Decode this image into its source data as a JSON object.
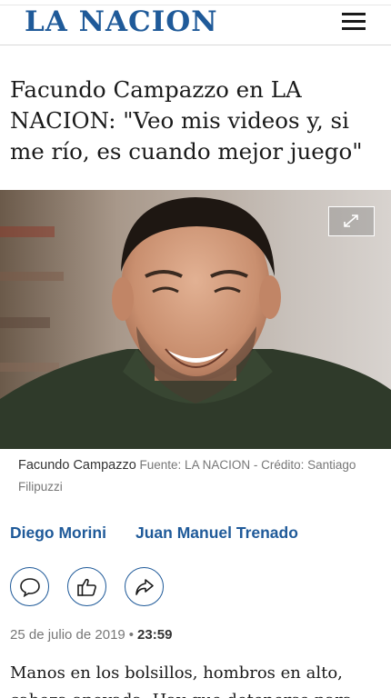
{
  "header": {
    "logo_text": "LA NACION",
    "menu_icon": "hamburger-menu-icon",
    "brand_color": "#1f5a99"
  },
  "article": {
    "headline": "Facundo Campazzo en LA NACION: \"Veo mis videos y, si me río, es cuando mejor juego\"",
    "photo": {
      "expand_icon": "expand-arrows-icon",
      "caption_name": "Facundo Campazzo",
      "caption_credit": "Fuente: LA NACION - Crédito: Santiago Filipuzzi"
    },
    "authors": [
      "Diego Morini",
      "Juan Manuel Trenado"
    ],
    "share_buttons": [
      {
        "icon": "comment-icon"
      },
      {
        "icon": "thumbs-up-icon"
      },
      {
        "icon": "share-arrow-icon"
      }
    ],
    "date": "25 de julio de 2019",
    "separator": "•",
    "time": "23:59",
    "body_first_line": "Manos en los bolsillos, hombros en alto,",
    "body_second_line": "cabeza apoyada. Hay que detenerse para"
  }
}
